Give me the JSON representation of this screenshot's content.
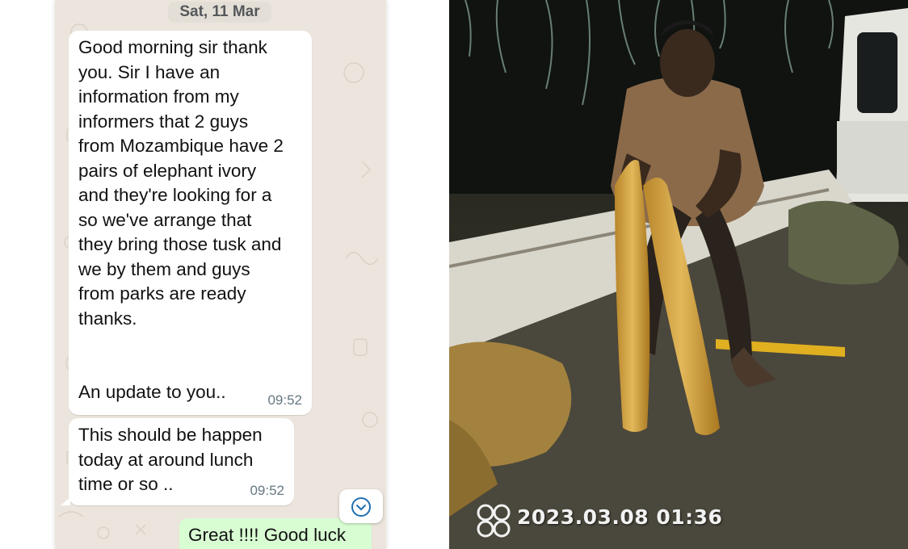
{
  "chat": {
    "date_chip": "Sat, 11 Mar",
    "messages": [
      {
        "direction": "incoming",
        "text": "Good morning sir thank\nyou. Sir I have an\ninformation from my\ninformers that  2 guys\nfrom Mozambique have 2\npairs of elephant ivory\nand they're looking for a\nso we've arrange that\nthey bring those tusk and\nwe by them and guys\nfrom parks are ready\nthanks.\n\n\nAn update to you..",
        "time": "09:52"
      },
      {
        "direction": "incoming",
        "text": "This should be happen\ntoday at around lunch\ntime or so ..",
        "time": "09:52"
      },
      {
        "direction": "outgoing",
        "text": "Great !!!! Good luck"
      }
    ],
    "scroll_button_icon": "chevron-down-icon",
    "colors": {
      "wallpaper": "#ece5dd",
      "incoming_bubble": "#ffffff",
      "outgoing_bubble": "#d9fdd3",
      "timestamp": "#667781"
    }
  },
  "photo": {
    "timestamp_overlay": "2023.03.08 01:36",
    "overlay_icon": "camera-watermark-icon"
  }
}
